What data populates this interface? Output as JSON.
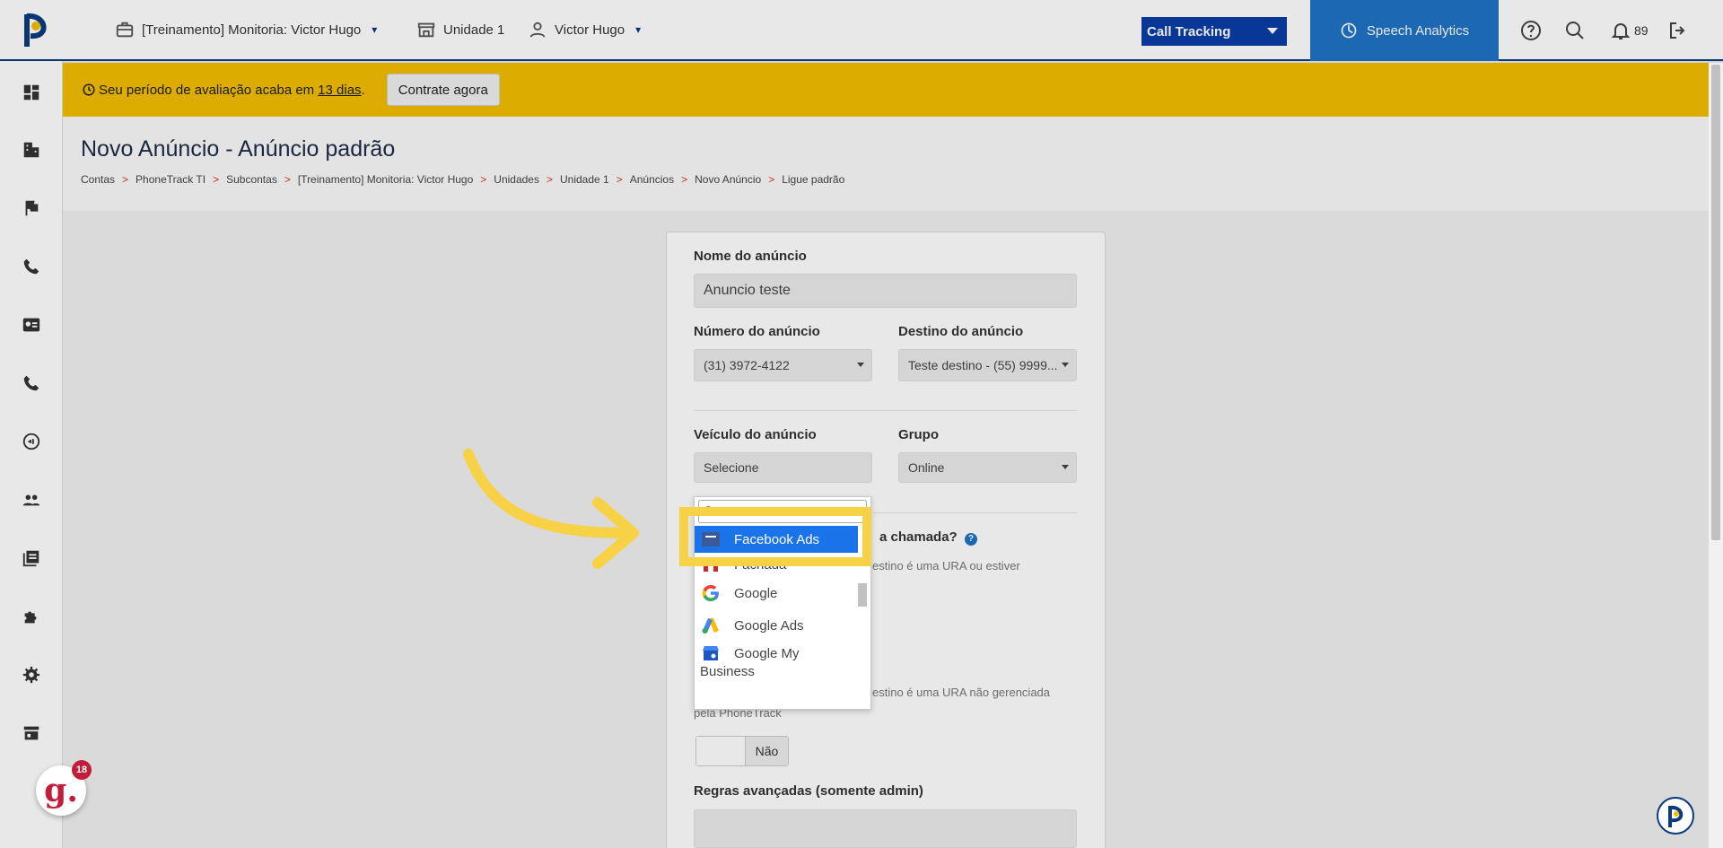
{
  "topbar": {
    "account": "[Treinamento] Monitoria: Victor Hugo",
    "unit": "Unidade 1",
    "user": "Victor Hugo",
    "product_select": "Call Tracking",
    "speech_analytics": "Speech Analytics",
    "notifications_count": "89"
  },
  "banner": {
    "text_before": "Seu período de avaliação acaba em",
    "days_link": "13 dias",
    "text_after": ".",
    "cta_label": "Contrate agora"
  },
  "page": {
    "title": "Novo Anúncio - Anúncio padrão",
    "breadcrumb": [
      "Contas",
      "PhoneTrack TI",
      "Subcontas",
      "[Treinamento] Monitoria: Victor Hugo",
      "Unidades",
      "Unidade 1",
      "Anúncios",
      "Novo Anúncio",
      "Ligue padrão"
    ],
    "breadcrumb_sep": ">"
  },
  "form": {
    "name_label": "Nome do anúncio",
    "name_value": "Anuncio teste",
    "number_label": "Número do anúncio",
    "number_value": "(31) 3972-4122",
    "destination_label": "Destino do anúncio",
    "destination_value": "Teste destino - (55) 9999...",
    "vehicle_label": "Veículo do anúncio",
    "vehicle_value": "Selecione",
    "group_label": "Grupo",
    "group_value": "Online",
    "question_partial": "a chamada?",
    "hint1_partial": "estino é uma URA ou estiver",
    "hint2_partial": "estino é uma URA não gerenciada",
    "hint2_line2": "pela PhoneTrack",
    "toggle_label": "Não",
    "advanced_label": "Regras avançadas (somente admin)"
  },
  "dropdown": {
    "options": [
      {
        "label": "Facebook Ads",
        "icon": "facebook-ads-icon",
        "selected": true
      },
      {
        "label": "Fachada",
        "icon": "storefront-icon",
        "selected": false
      },
      {
        "label": "Google",
        "icon": "google-icon",
        "selected": false
      },
      {
        "label": "Google Ads",
        "icon": "google-ads-icon",
        "selected": false
      },
      {
        "label": "Google My",
        "label2": "Business",
        "icon": "google-my-business-icon",
        "selected": false
      }
    ]
  },
  "badge": {
    "letter": "g.",
    "count": "18"
  },
  "colors": {
    "brand": "#0b3a7e",
    "banner": "#f2bf00",
    "highlight": "#f7d247",
    "selected": "#1a73e8",
    "speech": "#1f73c4"
  }
}
